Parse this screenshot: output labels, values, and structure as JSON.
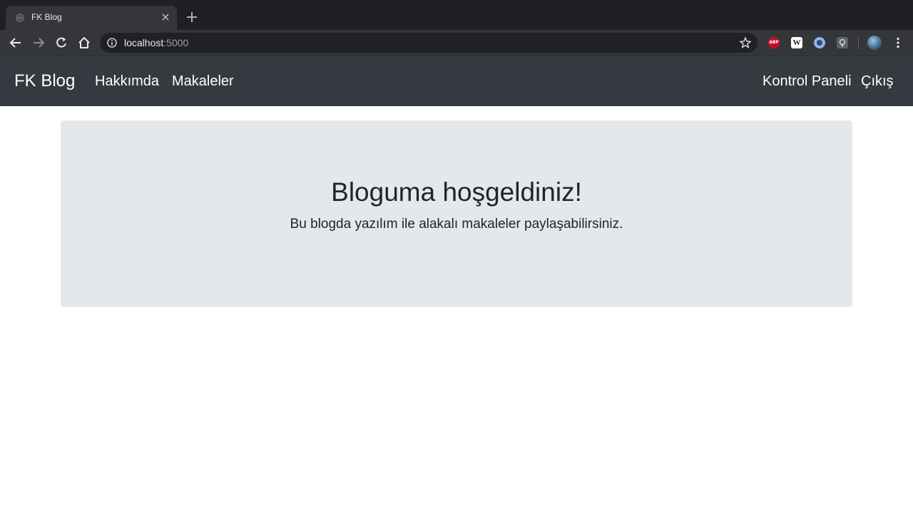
{
  "browser": {
    "tab_title": "FK Blog",
    "url_host": "localhost",
    "url_port": ":5000",
    "extensions": [
      "abp-icon",
      "w-icon",
      "circle-ext-icon",
      "bulb-ext-icon"
    ],
    "ext_abp_label": "ABP",
    "ext_w_label": "W"
  },
  "navbar": {
    "brand": "FK Blog",
    "left_links": [
      "Hakkımda",
      "Makaleler"
    ],
    "right_links": [
      "Kontrol Paneli",
      "Çıkış"
    ],
    "bg_color": "#343a40"
  },
  "jumbotron": {
    "title": "Bloguma hoşgeldiniz!",
    "lead": "Bu blogda yazılım ile alakalı makaleler paylaşabilirsiniz.",
    "bg_color": "#e4e8eb"
  }
}
